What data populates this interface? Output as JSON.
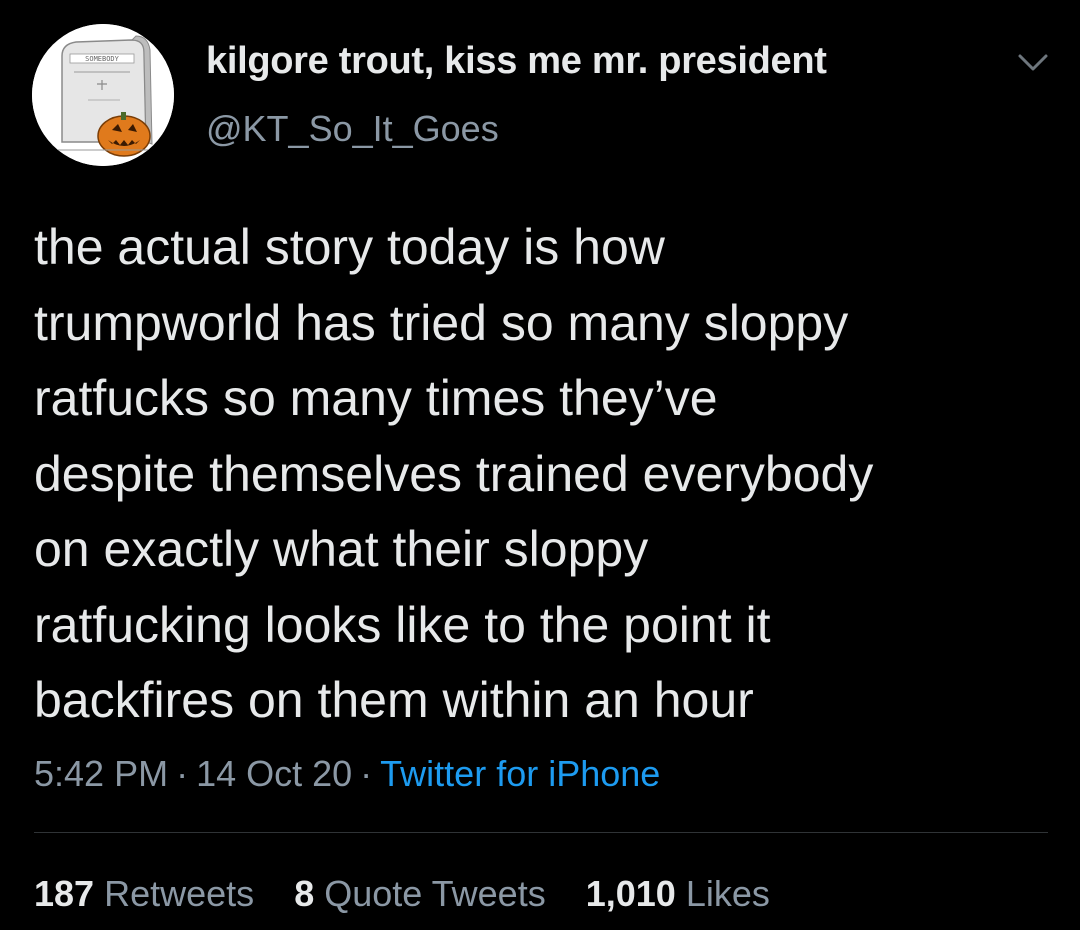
{
  "tweet": {
    "author": {
      "display_name": "kilgore trout, kiss me mr. president",
      "handle": "@KT_So_It_Goes",
      "avatar_icon": "tombstone-pumpkin-avatar",
      "avatar_text": "SOMEBODY"
    },
    "text": "the actual story today is how\ntrumpworld has tried so many sloppy\nratfucks so many times they’ve\ndespite themselves trained everybody\non exactly what their sloppy\nratfucking looks like to the point it\nbackfires on them within an hour",
    "time": "5:42 PM",
    "date": "14 Oct 20",
    "separator": "·",
    "source": "Twitter for iPhone",
    "stats": {
      "retweets": {
        "count": "187",
        "label": "Retweets"
      },
      "quote_tweets": {
        "count": "8",
        "label": "Quote Tweets"
      },
      "likes": {
        "count": "1,010",
        "label": "Likes"
      }
    }
  },
  "colors": {
    "background": "#000000",
    "primary_text": "#e7e9ea",
    "secondary_text": "#8b98a5",
    "link": "#1d9bf0",
    "divider": "#2f3336"
  }
}
